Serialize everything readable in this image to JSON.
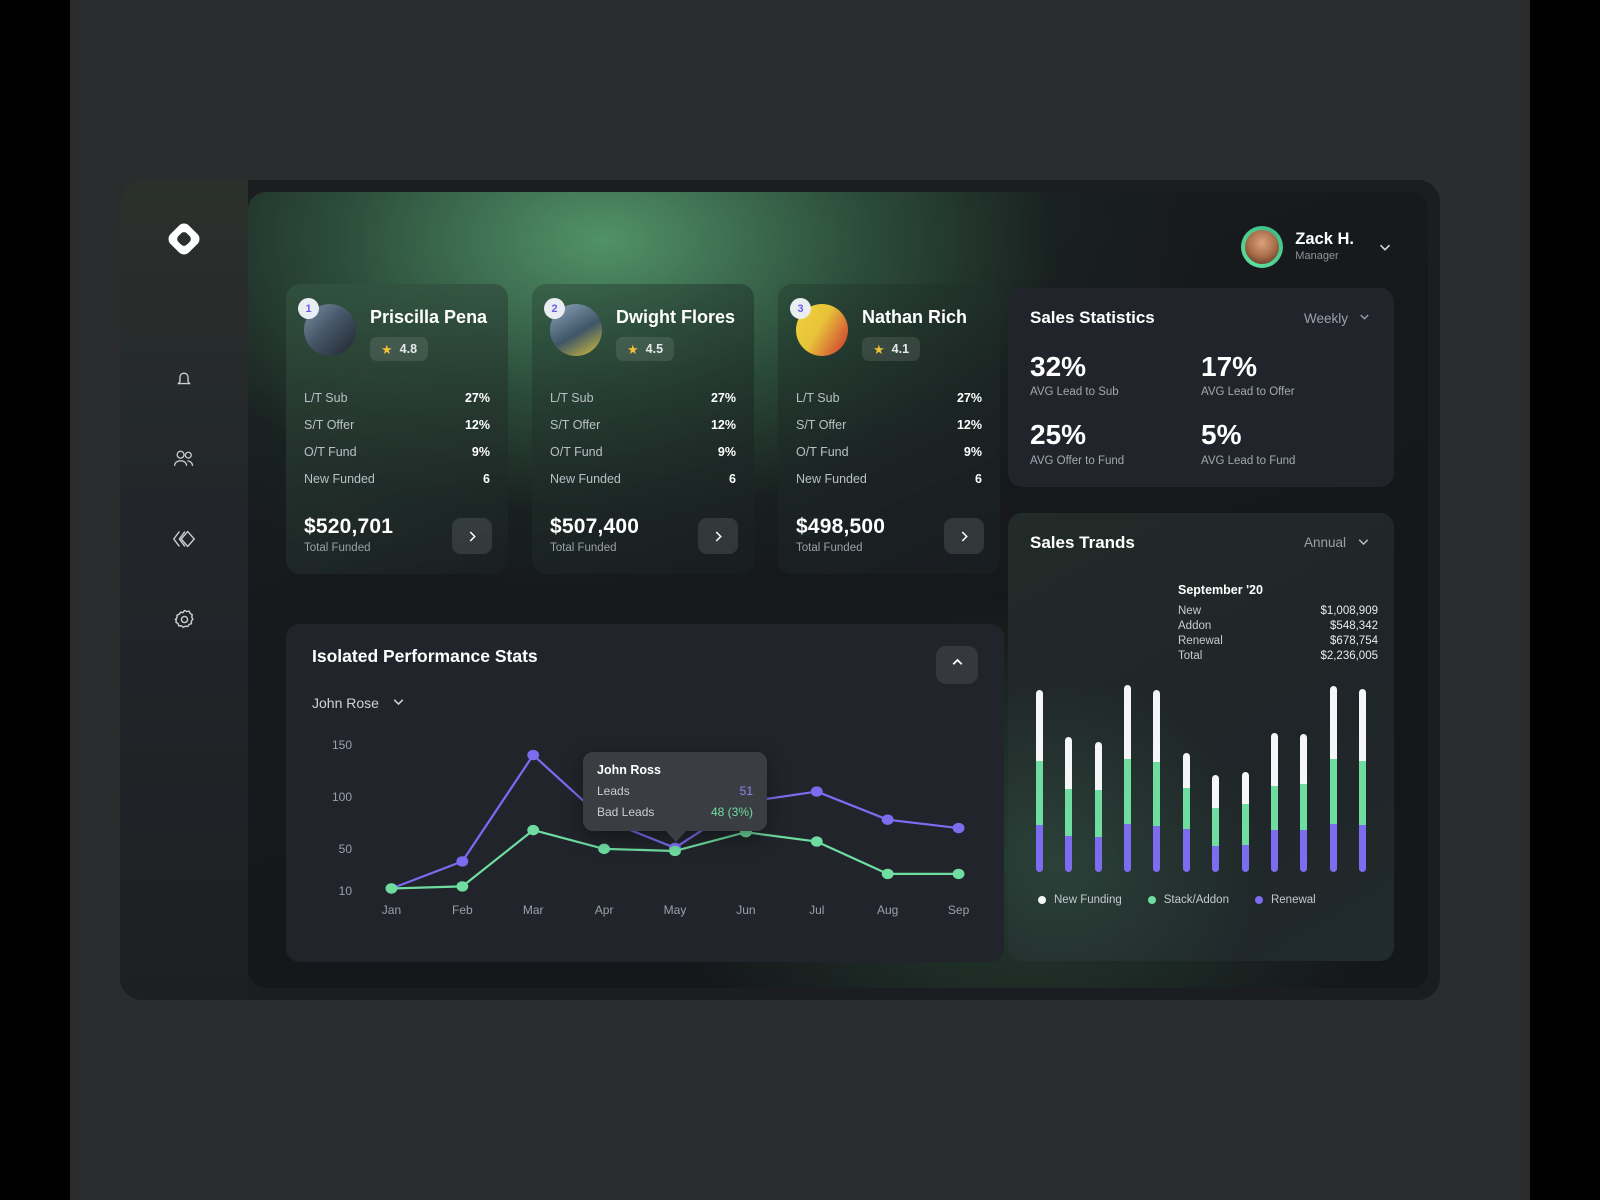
{
  "sidebar": {
    "logo": "diamond-logo",
    "items": [
      {
        "icon": "bell-icon",
        "name": "notifications"
      },
      {
        "icon": "users-icon",
        "name": "team"
      },
      {
        "icon": "collapse-icon",
        "name": "collapse"
      },
      {
        "icon": "gear-icon",
        "name": "settings"
      }
    ]
  },
  "header": {
    "user_name": "Zack H.",
    "user_role": "Manager",
    "chevron": "chevron-down-icon"
  },
  "agents": [
    {
      "rank": "1",
      "name": "Priscilla Pena",
      "rating": "4.8",
      "star": "★",
      "rows": [
        {
          "label": "L/T Sub",
          "value": "27%"
        },
        {
          "label": "S/T Offer",
          "value": "12%"
        },
        {
          "label": "O/T Fund",
          "value": "9%"
        },
        {
          "label": "New Funded",
          "value": "6"
        }
      ],
      "amount": "$520,701",
      "amount_label": "Total Funded"
    },
    {
      "rank": "2",
      "name": "Dwight Flores",
      "rating": "4.5",
      "star": "★",
      "rows": [
        {
          "label": "L/T Sub",
          "value": "27%"
        },
        {
          "label": "S/T Offer",
          "value": "12%"
        },
        {
          "label": "O/T Fund",
          "value": "9%"
        },
        {
          "label": "New Funded",
          "value": "6"
        }
      ],
      "amount": "$507,400",
      "amount_label": "Total Funded"
    },
    {
      "rank": "3",
      "name": "Nathan Rich",
      "rating": "4.1",
      "star": "★",
      "rows": [
        {
          "label": "L/T Sub",
          "value": "27%"
        },
        {
          "label": "S/T Offer",
          "value": "12%"
        },
        {
          "label": "O/T Fund",
          "value": "9%"
        },
        {
          "label": "New Funded",
          "value": "6"
        }
      ],
      "amount": "$498,500",
      "amount_label": "Total Funded"
    }
  ],
  "sales_statistics": {
    "title": "Sales Statistics",
    "period": "Weekly",
    "metrics": [
      {
        "value": "32%",
        "caption": "AVG Lead to Sub"
      },
      {
        "value": "17%",
        "caption": "AVG Lead to Offer"
      },
      {
        "value": "25%",
        "caption": "AVG Offer to Fund"
      },
      {
        "value": "5%",
        "caption": "AVG Lead to Fund"
      }
    ]
  },
  "sales_trends": {
    "title": "Sales Trands",
    "period": "Annual",
    "month": "September '20",
    "rows": [
      {
        "label": "New",
        "value": "$1,008,909"
      },
      {
        "label": "Addon",
        "value": "$548,342"
      },
      {
        "label": "Renewal",
        "value": "$678,754"
      },
      {
        "label": "Total",
        "value": "$2,236,005"
      }
    ],
    "legend": [
      {
        "label": "New Funding",
        "color": "#f4f6f8"
      },
      {
        "label": "Stack/Addon",
        "color": "#6fdca0"
      },
      {
        "label": "Renewal",
        "color": "#7c6cf0"
      }
    ]
  },
  "performance": {
    "title": "Isolated Performance Stats",
    "agent": "John Rose",
    "collapse_icon": "chevron-up-icon",
    "tooltip": {
      "name": "John Ross",
      "rows": [
        {
          "label": "Leads",
          "value": "51"
        },
        {
          "label": "Bad Leads",
          "value": "48 (3%)"
        }
      ]
    }
  },
  "chart_data": [
    {
      "type": "line",
      "title": "Isolated Performance Stats",
      "x": [
        "Jan",
        "Feb",
        "Mar",
        "Apr",
        "May",
        "Jun",
        "Jul",
        "Aug",
        "Sep"
      ],
      "ylabel": "",
      "xlabel": "",
      "yticks": [
        10,
        50,
        100,
        150
      ],
      "ylim": [
        0,
        165
      ],
      "grid": false,
      "legend": "none",
      "series": [
        {
          "name": "Leads",
          "color": "#7c6cf0",
          "values": [
            12,
            38,
            140,
            78,
            51,
            95,
            105,
            78,
            70
          ]
        },
        {
          "name": "Bad Leads",
          "color": "#6fdca0",
          "values": [
            12,
            14,
            68,
            50,
            48,
            66,
            57,
            26,
            26
          ]
        }
      ],
      "annotation": {
        "at": "May",
        "name": "John Ross",
        "leads": 51,
        "bad_leads": "48 (3%)"
      }
    },
    {
      "type": "bar",
      "title": "Sales Trands",
      "stacked": true,
      "categories": [
        "1",
        "2",
        "3",
        "4",
        "5",
        "6",
        "7",
        "8",
        "9",
        "10",
        "11",
        "12"
      ],
      "series": [
        {
          "name": "Renewal",
          "color": "#7c6cf0",
          "values": [
            42,
            32,
            31,
            43,
            41,
            38,
            23,
            24,
            37,
            37,
            43,
            42
          ]
        },
        {
          "name": "Stack/Addon",
          "color": "#6fdca0",
          "values": [
            57,
            42,
            42,
            58,
            57,
            37,
            34,
            37,
            40,
            42,
            58,
            57
          ]
        },
        {
          "name": "New Funding",
          "color": "#f4f6f8",
          "values": [
            64,
            47,
            43,
            66,
            65,
            31,
            30,
            28,
            47,
            44,
            65,
            65
          ]
        }
      ],
      "ylim": [
        0,
        170
      ]
    }
  ]
}
